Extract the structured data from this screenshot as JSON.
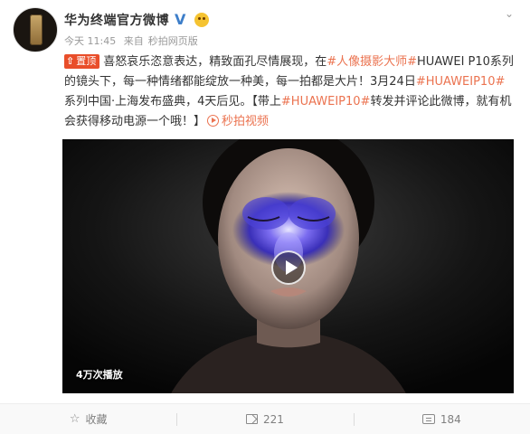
{
  "post": {
    "author": "华为终端官方微博",
    "verified_mark": "V",
    "time": "今天 11:45",
    "source_prefix": "来自",
    "source": "秒拍网页版",
    "pin_label": "置顶",
    "text": {
      "t1": "喜怒哀乐恣意表达，精致面孔尽情展现，在",
      "tag1": "#人像摄影大师#",
      "t2": "HUAWEI P10系列的镜头下，每一种情绪都能绽放一种美，每一拍都是大片！3月24日",
      "tag2": "#HUAWEIP10#",
      "t3": "系列中国·上海发布盛典，4天后见。【带上",
      "tag3": "#HUAWEIP10#",
      "t4": "转发并评论此微博，就有机会获得移动电源一个哦！】",
      "video_link": "秒拍视频"
    },
    "video": {
      "view_count": "4万次播放"
    }
  },
  "actions": {
    "favorite_label": "收藏",
    "repost_count": "221",
    "comment_count": "184"
  },
  "colors": {
    "accent": "#eb7350",
    "pin": "#e94e2a",
    "verified": "#3d7ec9"
  },
  "icons": [
    "chevron-down-icon",
    "verified-icon",
    "emoji-icon",
    "pin-icon",
    "play-circle-icon",
    "play-icon",
    "star-icon",
    "repost-icon",
    "comment-icon"
  ]
}
